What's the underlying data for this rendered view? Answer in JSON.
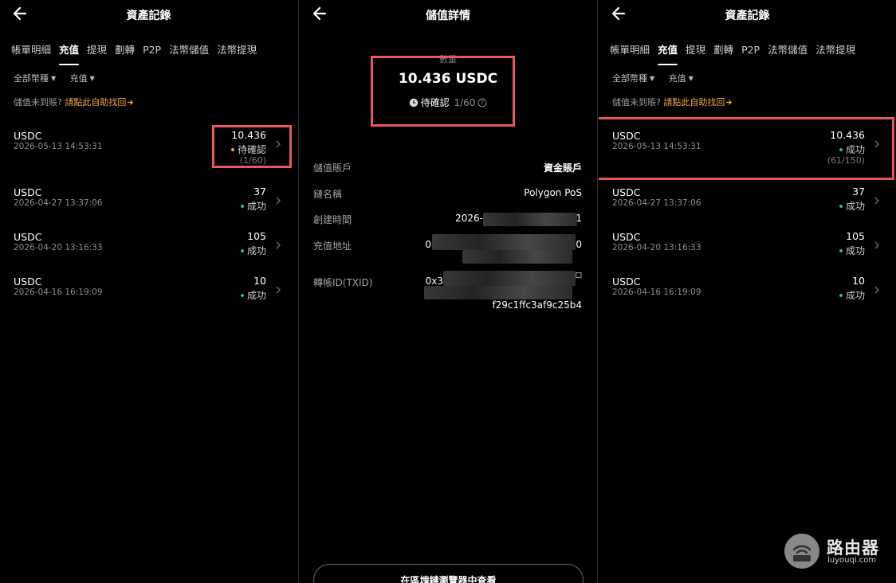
{
  "panel_left": {
    "title": "資產記錄",
    "tabs": [
      "帳單明細",
      "充值",
      "提現",
      "劃轉",
      "P2P",
      "法幣儲值",
      "法幣提現"
    ],
    "active_tab": "充值",
    "filters": [
      "全部幣種",
      "充值"
    ],
    "help_text": "儲值未到賬?",
    "help_link": "請點此自助找回",
    "records": [
      {
        "asset": "USDC",
        "time": "2026-05-13 14:53:31",
        "amount": "10.436",
        "status": "待確認",
        "status_color": "orange",
        "count": "(1/60)"
      },
      {
        "asset": "USDC",
        "time": "2026-04-27 13:37:06",
        "amount": "37",
        "status": "成功",
        "status_color": "green"
      },
      {
        "asset": "USDC",
        "time": "2026-04-20 13:16:33",
        "amount": "105",
        "status": "成功",
        "status_color": "green"
      },
      {
        "asset": "USDC",
        "time": "2026-04-16 16:19:09",
        "amount": "10",
        "status": "成功",
        "status_color": "green"
      }
    ]
  },
  "panel_detail": {
    "title": "儲值詳情",
    "amount_label": "數量",
    "amount": "10.436 USDC",
    "status": "待確認",
    "progress": "1/60",
    "fields": {
      "account_label": "儲值賬戶",
      "account_value": "資金賬戶",
      "chain_label": "鏈名稱",
      "chain_value": "Polygon PoS",
      "created_label": "創建時間",
      "created_value_start": "2026-",
      "created_value_end": "1",
      "address_label": "充值地址",
      "address_start": "0",
      "address_end": "0",
      "txid_label": "轉帳ID(TXID)",
      "txid_start": "0x3",
      "txid_end": "f29c1ffc3af9c25b4"
    },
    "explorer_button": "在區塊鏈瀏覽器中查看"
  },
  "panel_right": {
    "title": "資產記錄",
    "tabs": [
      "帳單明細",
      "充值",
      "提現",
      "劃轉",
      "P2P",
      "法幣儲值",
      "法幣提現"
    ],
    "active_tab": "充值",
    "filters": [
      "全部幣種",
      "充值"
    ],
    "help_text": "儲值未到賬?",
    "help_link": "請點此自助找回",
    "records": [
      {
        "asset": "USDC",
        "time": "2026-05-13 14:53:31",
        "amount": "10.436",
        "status": "成功",
        "status_color": "green",
        "count": "(61/150)"
      },
      {
        "asset": "USDC",
        "time": "2026-04-27 13:37:06",
        "amount": "37",
        "status": "成功",
        "status_color": "green"
      },
      {
        "asset": "USDC",
        "time": "2026-04-20 13:16:33",
        "amount": "105",
        "status": "成功",
        "status_color": "green"
      },
      {
        "asset": "USDC",
        "time": "2026-04-16 16:19:09",
        "amount": "10",
        "status": "成功",
        "status_color": "green"
      }
    ]
  },
  "watermark": {
    "name_cn": "路由器",
    "site": "luyouqi.com"
  },
  "colors": {
    "accent_link": "#f0a54a",
    "success": "#2ebd85",
    "pending": "#f0a54a",
    "highlight": "#e8575c"
  }
}
